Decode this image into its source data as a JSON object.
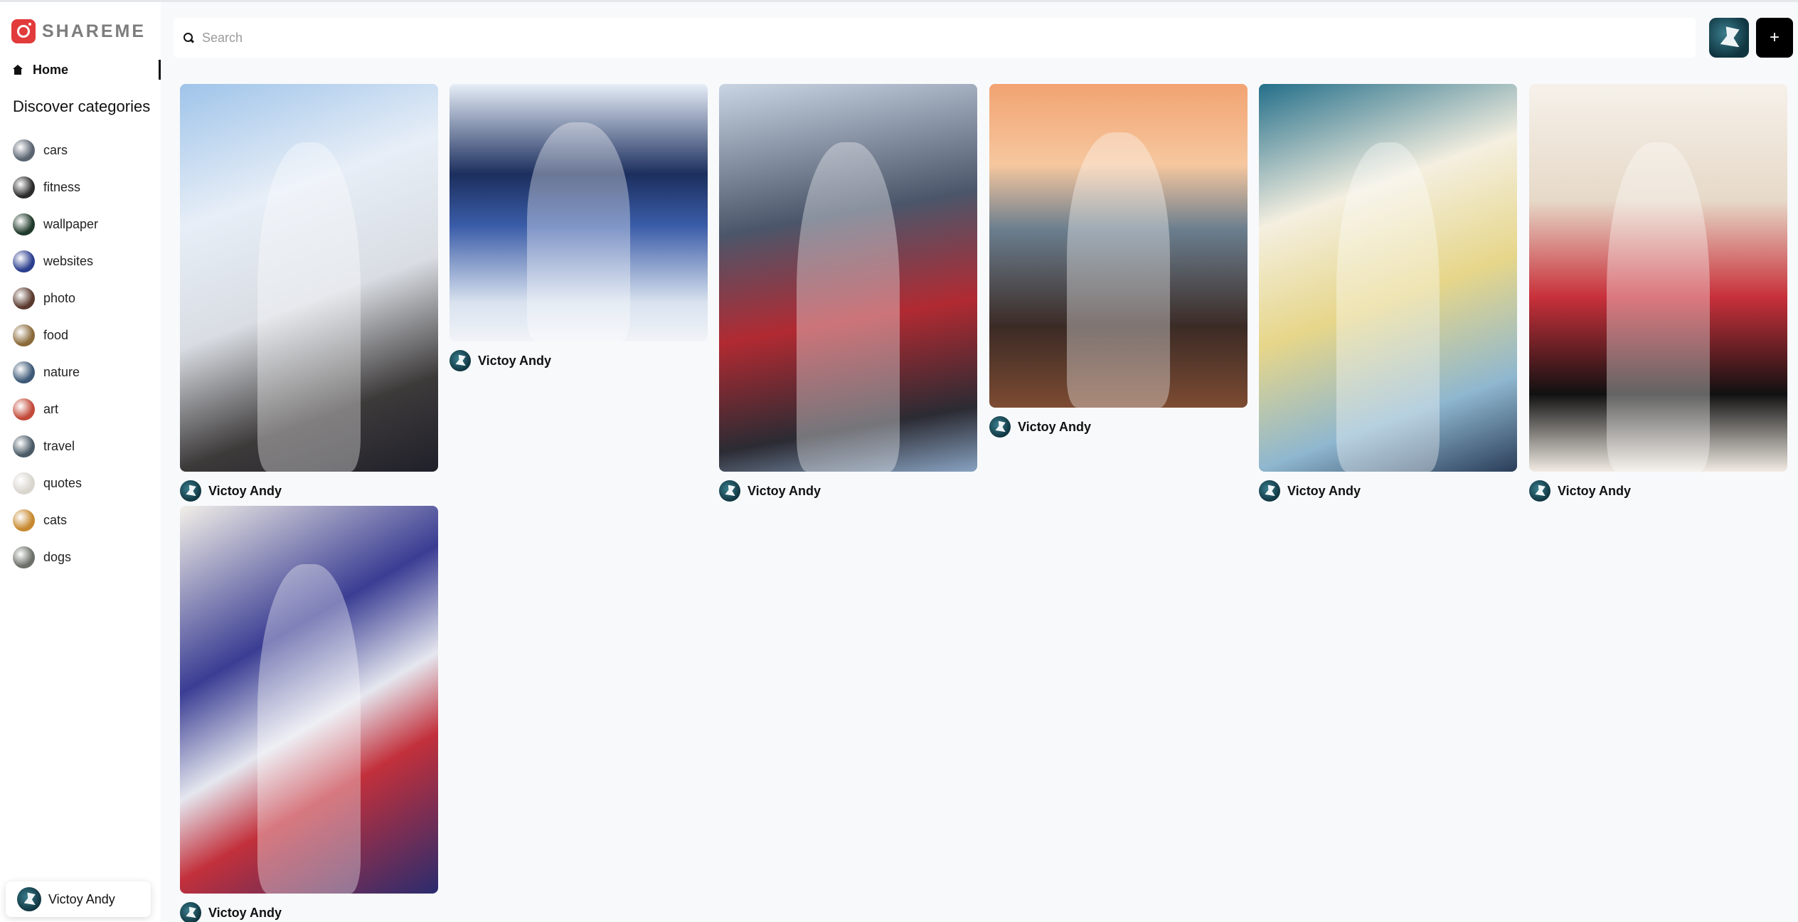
{
  "app": {
    "name": "SHAREME"
  },
  "nav": {
    "home_label": "Home"
  },
  "categories": {
    "heading": "Discover categories",
    "items": [
      {
        "label": "cars",
        "color": "#5a6470"
      },
      {
        "label": "fitness",
        "color": "#2b2b2b"
      },
      {
        "label": "wallpaper",
        "color": "#1f3a2a"
      },
      {
        "label": "websites",
        "color": "#2c3f8f"
      },
      {
        "label": "photo",
        "color": "#5b3a2e"
      },
      {
        "label": "food",
        "color": "#8a6a3a"
      },
      {
        "label": "nature",
        "color": "#3e5a78"
      },
      {
        "label": "art",
        "color": "#c24a3a"
      },
      {
        "label": "travel",
        "color": "#4a5a66"
      },
      {
        "label": "quotes",
        "color": "#d9d6cf"
      },
      {
        "label": "cats",
        "color": "#c7892f"
      },
      {
        "label": "dogs",
        "color": "#6b7068"
      }
    ]
  },
  "search": {
    "placeholder": "Search",
    "value": ""
  },
  "header": {
    "create_label": "+"
  },
  "user": {
    "name": "Victoy Andy"
  },
  "pins": [
    {
      "author": "Victoy Andy",
      "art": "art-1"
    },
    {
      "author": "Victoy Andy",
      "art": "art-2"
    },
    {
      "author": "Victoy Andy",
      "art": "art-3"
    },
    {
      "author": "Victoy Andy",
      "art": "art-4"
    },
    {
      "author": "Victoy Andy",
      "art": "art-5"
    },
    {
      "author": "Victoy Andy",
      "art": "art-6"
    },
    {
      "author": "Victoy Andy",
      "art": "art-7"
    }
  ]
}
